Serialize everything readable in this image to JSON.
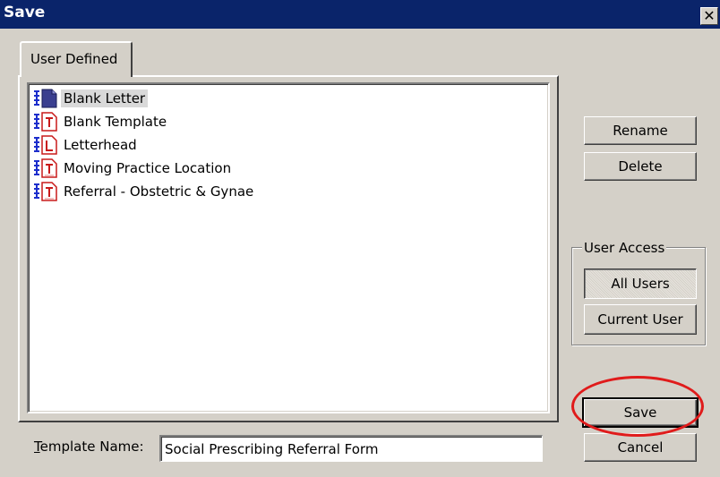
{
  "window": {
    "title": "Save",
    "close_glyph": "✕"
  },
  "tabs": [
    {
      "label": "User Defined"
    }
  ],
  "templates": {
    "items": [
      {
        "label": "Blank Letter",
        "icon": "blank-document-icon",
        "selected": true
      },
      {
        "label": "Blank Template",
        "icon": "template-document-icon",
        "selected": false
      },
      {
        "label": "Letterhead",
        "icon": "letterhead-document-icon",
        "selected": false
      },
      {
        "label": "Moving Practice Location",
        "icon": "template-document-icon",
        "selected": false
      },
      {
        "label": "Referral - Obstetric & Gynae",
        "icon": "template-document-icon",
        "selected": false
      }
    ]
  },
  "actions": {
    "rename_label": "Rename",
    "delete_label": "Delete",
    "save_label": "Save",
    "cancel_label": "Cancel"
  },
  "user_access": {
    "title": "User Access",
    "all_users_label": "All Users",
    "current_user_label": "Current User",
    "selected": "All Users"
  },
  "template_name": {
    "label_underlined_char": "T",
    "label_rest": "emplate Name:",
    "value": "Social Prescribing Referral Form"
  },
  "colors": {
    "titlebar": "#0a246a",
    "face": "#d4d0c8",
    "highlight_ring": "#e01b1b"
  }
}
